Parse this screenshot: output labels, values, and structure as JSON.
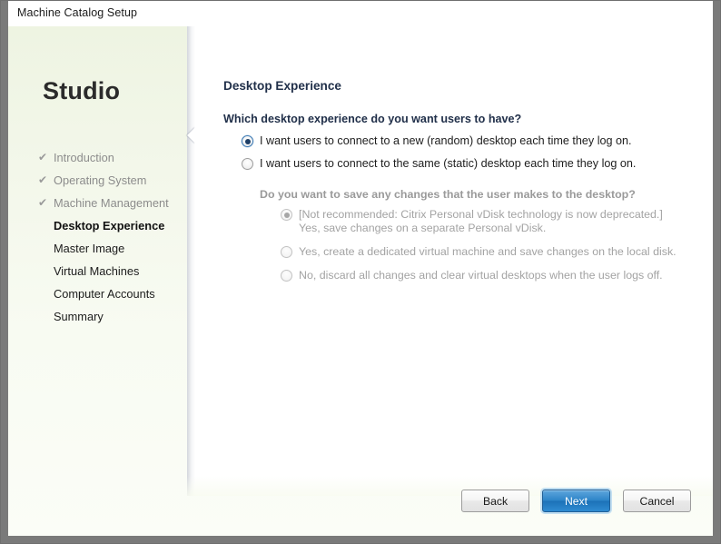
{
  "window": {
    "title": "Machine Catalog Setup"
  },
  "sidebar": {
    "logo": "Studio",
    "check_glyph": "✔",
    "items": [
      {
        "label": "Introduction",
        "state": "done"
      },
      {
        "label": "Operating System",
        "state": "done"
      },
      {
        "label": "Machine Management",
        "state": "done"
      },
      {
        "label": "Desktop Experience",
        "state": "current"
      },
      {
        "label": "Master Image",
        "state": "pending"
      },
      {
        "label": "Virtual Machines",
        "state": "pending"
      },
      {
        "label": "Computer Accounts",
        "state": "pending"
      },
      {
        "label": "Summary",
        "state": "pending"
      }
    ]
  },
  "main": {
    "page_title": "Desktop Experience",
    "question": "Which desktop experience do you want users to have?",
    "options": [
      {
        "label": "I want users to connect to a new (random) desktop each time they log on.",
        "selected": true
      },
      {
        "label": "I want users to connect to the same (static) desktop each time they log on.",
        "selected": false
      }
    ],
    "sub_question": "Do you want to save any changes that the user makes to the desktop?",
    "sub_options": [
      {
        "label_line1": "[Not recommended: Citrix Personal vDisk technology is now deprecated.]",
        "label_line2": "Yes, save changes on a separate Personal vDisk.",
        "selected": true,
        "disabled": true
      },
      {
        "label_line1": "Yes, create a dedicated virtual machine and save changes on the local disk.",
        "label_line2": "",
        "selected": false,
        "disabled": true
      },
      {
        "label_line1": "No, discard all changes and clear virtual desktops when the user logs off.",
        "label_line2": "",
        "selected": false,
        "disabled": true
      }
    ]
  },
  "footer": {
    "back_label": "Back",
    "next_label": "Next",
    "cancel_label": "Cancel"
  },
  "colors": {
    "accent_blue": "#1c72b8",
    "radio_selected": "#1f3f66",
    "heading": "#21304a",
    "disabled_text": "#a3a3a3",
    "frame": "#7a7a7a"
  }
}
